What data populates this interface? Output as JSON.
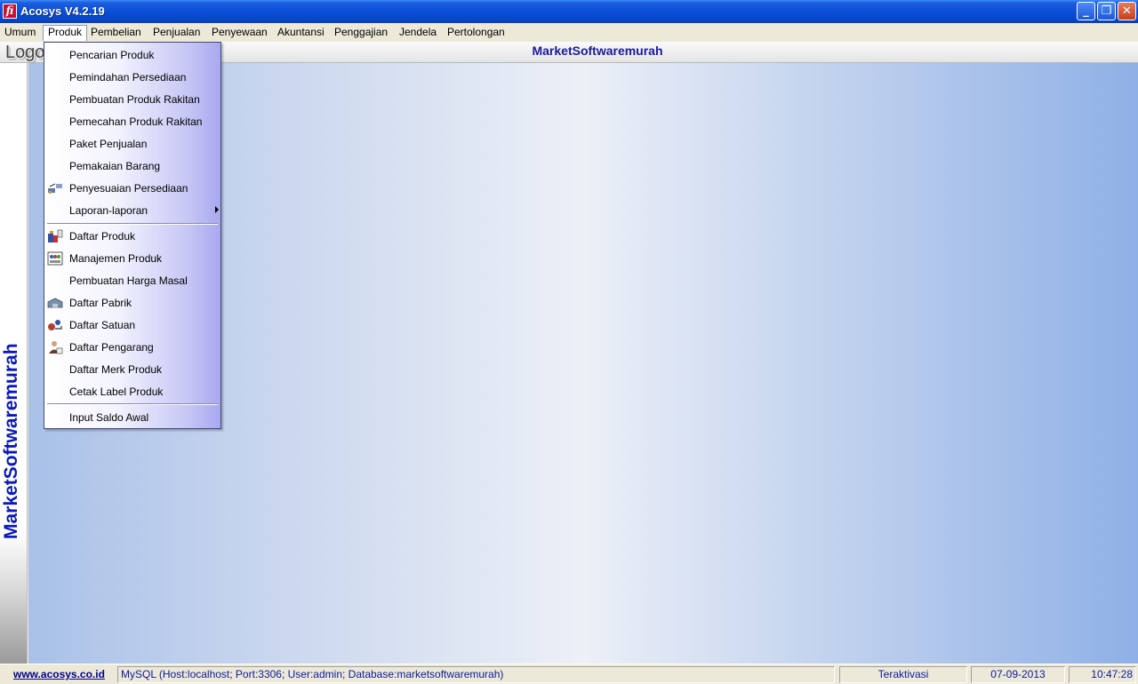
{
  "window": {
    "title": "Acosys V4.2.19",
    "app_icon_glyph": "fi",
    "controls": {
      "minimize": "_",
      "restore": "❐",
      "close": "✕"
    }
  },
  "menubar": {
    "items": [
      {
        "id": "umum",
        "label": "Umum"
      },
      {
        "id": "produk",
        "label": "Produk",
        "active": true
      },
      {
        "id": "pembelian",
        "label": "Pembelian"
      },
      {
        "id": "penjualan",
        "label": "Penjualan"
      },
      {
        "id": "penyewaan",
        "label": "Penyewaan"
      },
      {
        "id": "akuntansi",
        "label": "Akuntansi"
      },
      {
        "id": "penggajian",
        "label": "Penggajian"
      },
      {
        "id": "jendela",
        "label": "Jendela"
      },
      {
        "id": "pertolongan",
        "label": "Pertolongan"
      }
    ]
  },
  "header": {
    "logo_text": "Logo",
    "title": "MarketSoftwaremurah"
  },
  "side_banner": {
    "text": "MarketSoftwaremurah"
  },
  "produk_menu": {
    "items": [
      {
        "label": "Pencarian Produk",
        "icon": null
      },
      {
        "label": "Pemindahan Persediaan",
        "icon": null
      },
      {
        "label": "Pembuatan Produk Rakitan",
        "icon": null
      },
      {
        "label": "Pemecahan Produk Rakitan",
        "icon": null
      },
      {
        "label": "Paket Penjualan",
        "icon": null
      },
      {
        "label": "Pemakaian Barang",
        "icon": null
      },
      {
        "label": "Penyesuaian Persediaan",
        "icon": "adjustment-icon"
      },
      {
        "label": "Laporan-laporan",
        "icon": null,
        "submenu": true
      },
      {
        "separator": true
      },
      {
        "label": "Daftar Produk",
        "icon": "product-list-icon"
      },
      {
        "label": "Manajemen Produk",
        "icon": "product-management-icon"
      },
      {
        "label": "Pembuatan Harga Masal",
        "icon": null
      },
      {
        "label": "Daftar Pabrik",
        "icon": "factory-icon"
      },
      {
        "label": "Daftar Satuan",
        "icon": "unit-icon"
      },
      {
        "label": "Daftar Pengarang",
        "icon": "author-icon"
      },
      {
        "label": "Daftar Merk Produk",
        "icon": null
      },
      {
        "label": "Cetak Label Produk",
        "icon": null
      },
      {
        "separator": true
      },
      {
        "label": "Input Saldo Awal",
        "icon": null
      }
    ]
  },
  "statusbar": {
    "link": "www.acosys.co.id",
    "database": "MySQL (Host:localhost; Port:3306; User:admin; Database:marketsoftwaremurah)",
    "status": "Teraktivasi",
    "date": "07-09-2013",
    "time": "10:47:28"
  },
  "colors": {
    "titlebar": "#0a4fd6",
    "header_title": "#1a1a9a",
    "side_text": "#0a1ab8",
    "statusbar_text": "#0a1a9a"
  }
}
